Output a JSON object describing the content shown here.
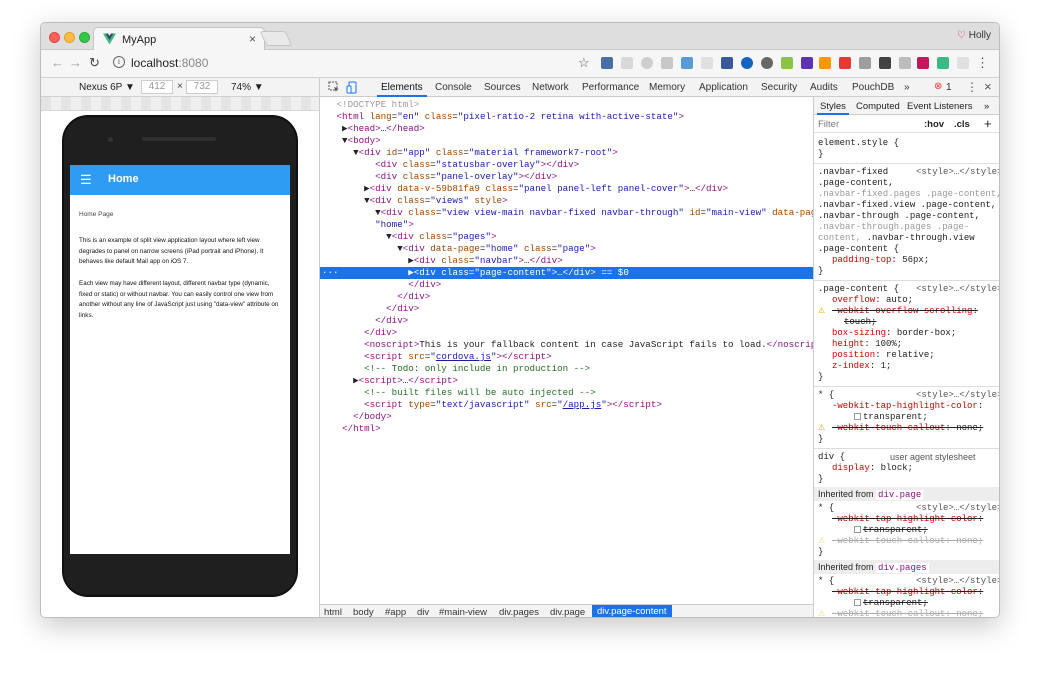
{
  "browser": {
    "tab_title": "MyApp",
    "tab_close": "×",
    "profile_name": "Holly",
    "url_host": "localhost",
    "url_port": ":8080"
  },
  "device_toolbar": {
    "device": "Nexus 6P ▼",
    "width": "412",
    "times": "×",
    "height": "732",
    "zoom": "74% ▼"
  },
  "app": {
    "header_title": "Home",
    "breadcrumb": "Home Page",
    "para1": "This is an example of split view application layout where left view degrades to panel on narrow screens (iPad portrait and iPhone). It behaves like default Mail app on iOS 7.",
    "para2": "Each view may have different layout, different navbar type (dynamic, fixed or static) or without navbar. You can easily control one view from another without any line of JavaScript just using \"data-view\" attribute on links."
  },
  "devtools": {
    "tabs": [
      "Elements",
      "Console",
      "Sources",
      "Network",
      "Performance",
      "Memory",
      "Application",
      "Security",
      "Audits",
      "PouchDB"
    ],
    "more": "»",
    "error_count": "1",
    "breadcrumb": [
      "html",
      "body",
      "#app",
      "div",
      "#main-view",
      "div.pages",
      "div.page",
      "div.page-content"
    ]
  },
  "styles_pane": {
    "tabs": [
      "Styles",
      "Computed",
      "Event Listeners"
    ],
    "more": "»",
    "filter_placeholder": "Filter",
    "hov": ":hov",
    "cls": ".cls",
    "add": "+",
    "inherited_label": "Inherited from",
    "inherited_1": "div.page",
    "inherited_2": "div.pages"
  },
  "colors": {
    "accent": "#1a73e8",
    "app_bar": "#2f9cf4",
    "tag": "#881280",
    "attr_name": "#994500",
    "attr_value": "#1a1aa6",
    "comment": "#236e25",
    "css_property": "#c80000"
  }
}
